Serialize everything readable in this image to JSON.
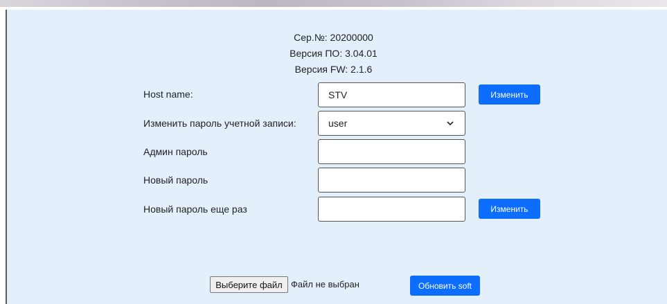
{
  "info": {
    "serial": "Сер.№: 20200000",
    "software_version": "Версия ПО: 3.04.01",
    "firmware_version": "Версия FW: 2.1.6"
  },
  "form": {
    "host_name": {
      "label": "Host name:",
      "value": "STV",
      "button_label": "Изменить"
    },
    "account": {
      "label": "Изменить пароль учетной записи:",
      "selected": "user"
    },
    "admin_password": {
      "label": "Админ пароль",
      "value": ""
    },
    "new_password": {
      "label": "Новый пароль",
      "value": ""
    },
    "new_password_repeat": {
      "label": "Новый пароль еще раз",
      "value": "",
      "button_label": "Изменить"
    }
  },
  "upload": {
    "choose_file_label": "Выберите файл",
    "file_status": "Файл не выбран",
    "update_button_label": "Обновить soft"
  },
  "colors": {
    "panel_bg": "#e3f0fb",
    "button_bg": "#0d6efd"
  },
  "icons": {
    "select_arrow": "chevron-down-icon"
  }
}
